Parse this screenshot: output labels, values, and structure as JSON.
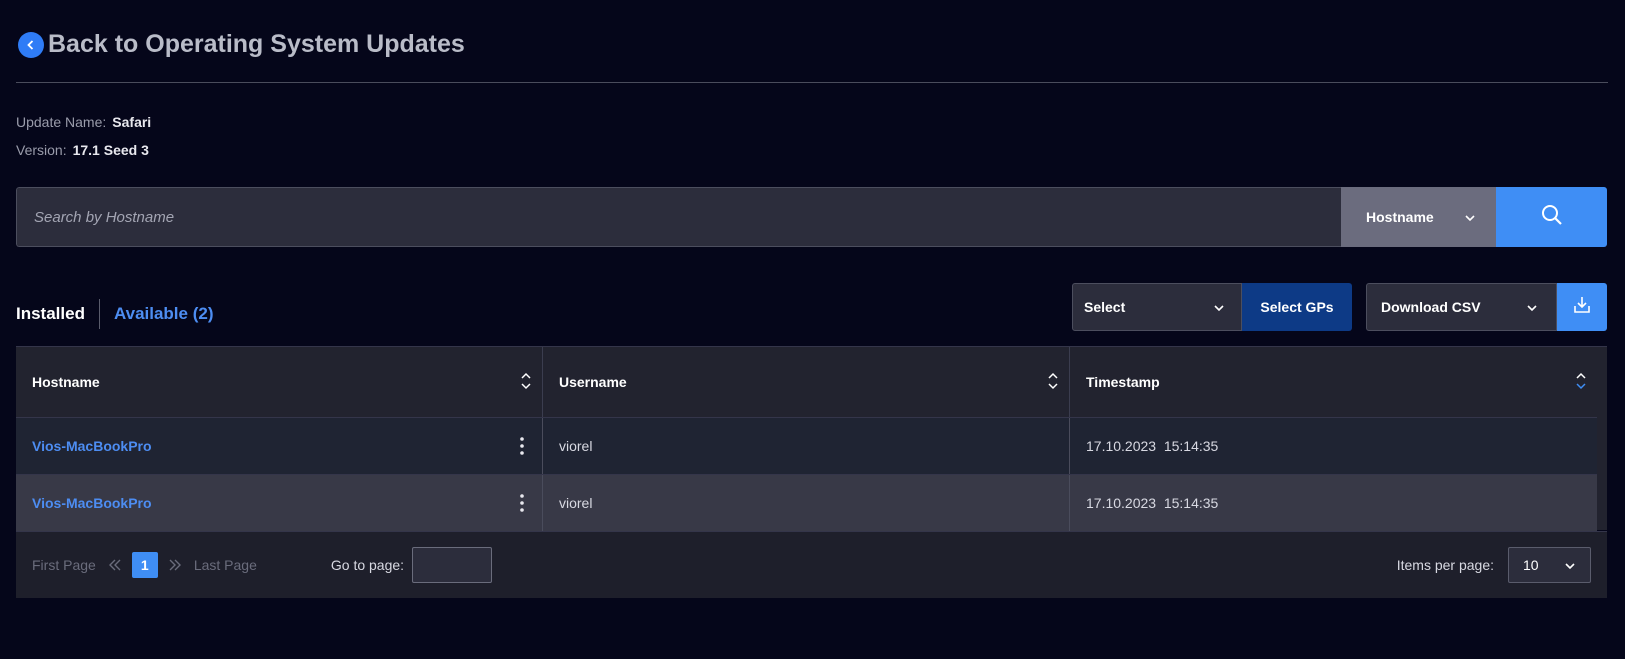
{
  "header": {
    "back_label": "Back to Operating System Updates"
  },
  "details": {
    "update_name_label": "Update Name:",
    "update_name_value": "Safari",
    "version_label": "Version:",
    "version_value": "17.1 Seed 3"
  },
  "search": {
    "placeholder": "Search by Hostname",
    "field_selected": "Hostname"
  },
  "tabs": {
    "installed": "Installed",
    "available": "Available (2)"
  },
  "toolbar": {
    "select_label": "Select",
    "select_gps": "Select GPs",
    "download_csv": "Download CSV"
  },
  "table": {
    "columns": [
      "Hostname",
      "Username",
      "Timestamp"
    ],
    "rows": [
      {
        "hostname": "Vios-MacBookPro",
        "username": "viorel",
        "timestamp": "17.10.2023  15:14:35"
      },
      {
        "hostname": "Vios-MacBookPro",
        "username": "viorel",
        "timestamp": "17.10.2023  15:14:35"
      }
    ]
  },
  "pagination": {
    "first_page": "First Page",
    "current_page": "1",
    "last_page": "Last Page",
    "go_to_label": "Go to page:",
    "items_per_page_label": "Items per page:",
    "items_per_page": "10"
  },
  "colors": {
    "accent": "#3f8ef5",
    "link": "#4d8df2",
    "background": "#05061a",
    "select_gps_bg": "#0d3a86"
  },
  "icons": [
    "chevron-left-icon",
    "chevron-down-icon",
    "search-icon",
    "sort-icon",
    "kebab-menu-icon",
    "download-icon",
    "double-chevron-left-icon",
    "double-chevron-right-icon"
  ]
}
